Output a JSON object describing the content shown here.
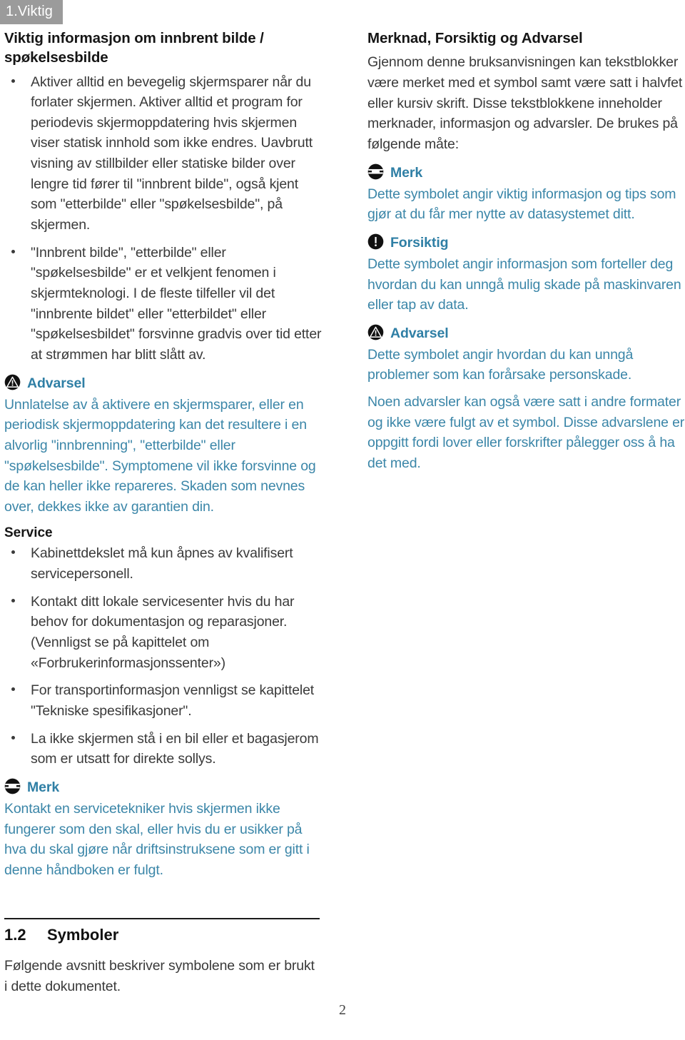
{
  "chapter_tab": "1.Viktig",
  "left_column": {
    "section_title": "Viktig informasjon om innbrent bilde / spøkelsesbilde",
    "bullets": [
      "Aktiver alltid en bevegelig skjermsparer når du forlater skjermen. Aktiver alltid et program for periodevis skjermoppdatering hvis skjermen viser statisk innhold som ikke endres. Uavbrutt visning av stillbilder eller statiske bilder over lengre tid fører til \"innbrent bilde\", også kjent som \"etterbilde\" eller \"spøkelsesbilde\", på skjermen.",
      "\"Innbrent bilde\", \"etterbilde\" eller \"spøkelsesbilde\" er et velkjent fenomen i skjermteknologi. I de fleste tilfeller vil det \"innbrente bildet\" eller \"etterbildet\" eller \"spøkelsesbildet\" forsvinne gradvis over tid etter at strømmen har blitt slått av."
    ],
    "warning": {
      "icon": "warning-triangle-circle-icon",
      "label": "Advarsel",
      "body": "Unnlatelse av å aktivere en skjermsparer, eller en periodisk skjermoppdatering kan det resultere i en alvorlig \"innbrenning\", \"etterbilde\" eller \"spøkelsesbilde\". Symptomene vil ikke forsvinne og de kan heller ikke repareres. Skaden som nevnes over, dekkes ikke av garantien din."
    },
    "service_title": "Service",
    "service_bullets": [
      "Kabinettdekslet må kun åpnes av kvalifisert servicepersonell.",
      "Kontakt ditt lokale servicesenter hvis du har behov for dokumentasjon og reparasjoner. (Vennligst se på kapittelet om «Forbrukerinformasjonssenter»)",
      "For transportinformasjon vennligst se kapittelet \"Tekniske spesifikasjoner\".",
      "La ikke skjermen stå i en bil eller et bagasjerom som er utsatt for direkte sollys."
    ],
    "note": {
      "icon": "note-lines-circle-icon",
      "label": "Merk",
      "body": "Kontakt en servicetekniker hvis skjermen ikke fungerer som den skal, eller hvis du er usikker på hva du skal gjøre når driftsinstruksene som er gitt i denne håndboken er fulgt."
    }
  },
  "right_column": {
    "section_title": "Merknad, Forsiktig og Advarsel",
    "intro": "Gjennom denne bruksanvisningen kan tekstblokker være merket med et symbol samt være satt i halvfet eller kursiv skrift. Disse tekstblokkene inneholder merknader, informasjon og advarsler. De brukes på følgende måte:",
    "note": {
      "icon": "note-lines-circle-icon",
      "label": "Merk",
      "body": "Dette symbolet angir viktig informasjon og tips som gjør at du får mer nytte av datasystemet ditt."
    },
    "caution": {
      "icon": "exclamation-circle-icon",
      "label": "Forsiktig",
      "body": "Dette symbolet angir informasjon som forteller deg hvordan du kan unngå mulig skade på maskinvaren eller tap av data."
    },
    "warning": {
      "icon": "warning-triangle-circle-icon",
      "label": "Advarsel",
      "body": "Dette symbolet angir hvordan du kan unngå problemer som kan forårsake personskade.",
      "body2": "Noen advarsler kan også være satt i andre formater og ikke være fulgt av et symbol. Disse advarslene er oppgitt fordi lover eller forskrifter pålegger oss å ha det med."
    }
  },
  "bottom_section": {
    "number": "1.2",
    "title": "Symboler",
    "body": "Følgende avsnitt beskriver symbolene som er brukt i dette dokumentet."
  },
  "page_number": "2",
  "colors": {
    "tab_background": "#9b9b9b",
    "callout_heading": "#2f7fa5",
    "callout_body": "#3b86a8",
    "body_text": "#3a3a3a",
    "heading_text": "#151515"
  }
}
